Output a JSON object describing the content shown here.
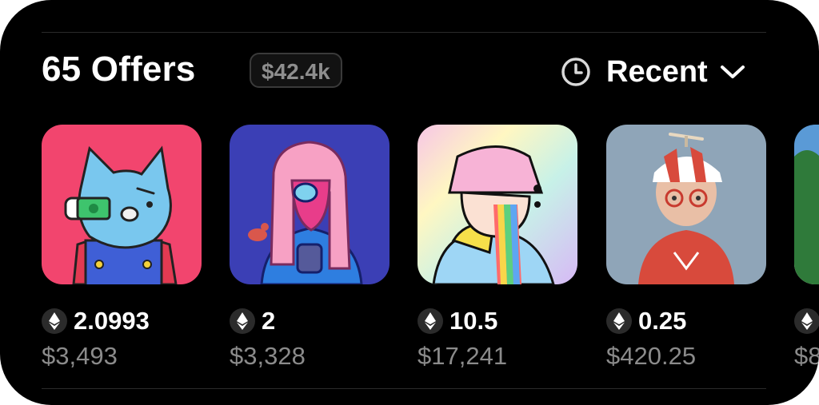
{
  "header": {
    "title": "65 Offers",
    "total_badge": "$42.4k",
    "sort_label": "Recent",
    "sort_icon": "clock-icon",
    "dropdown_icon": "chevron-down-icon"
  },
  "offers": [
    {
      "eth": "2.0993",
      "usd": "$3,493",
      "currency_icon": "ethereum-icon"
    },
    {
      "eth": "2",
      "usd": "$3,328",
      "currency_icon": "ethereum-icon"
    },
    {
      "eth": "10.5",
      "usd": "$17,241",
      "currency_icon": "ethereum-icon"
    },
    {
      "eth": "0.25",
      "usd": "$420.25",
      "currency_icon": "ethereum-icon"
    },
    {
      "eth": "",
      "usd": "$8",
      "currency_icon": "ethereum-icon"
    }
  ],
  "colors": {
    "background": "#000000",
    "muted_text": "#8b8b8b",
    "badge_border": "#3a3a3a"
  }
}
